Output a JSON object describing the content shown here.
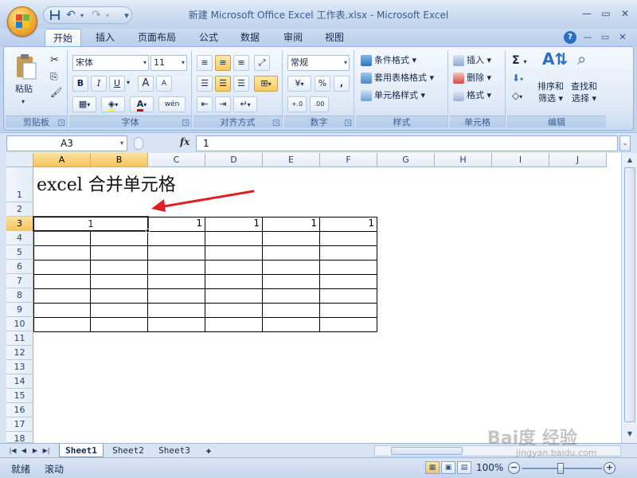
{
  "window": {
    "title": "新建 Microsoft Office Excel 工作表.xlsx - Microsoft Excel",
    "minimize": "—",
    "restore": "❐",
    "close": "✕"
  },
  "qat": {
    "save_icon": "save-icon",
    "undo": "↶",
    "redo": "↷",
    "customize": "▾"
  },
  "tabs": [
    "开始",
    "插入",
    "页面布局",
    "公式",
    "数据",
    "审阅",
    "视图"
  ],
  "ribbon": {
    "clipboard": {
      "label": "剪贴板",
      "paste": "粘贴"
    },
    "font": {
      "label": "字体",
      "name": "宋体",
      "size": "11",
      "bold": "B",
      "italic": "I",
      "underline": "U",
      "grow": "A",
      "shrink": "A",
      "phonetic": "wén"
    },
    "alignment": {
      "label": "对齐方式"
    },
    "number": {
      "label": "数字",
      "format": "常规",
      "percent": "%",
      "comma": ",",
      "inc": "+.0 .00",
      "dec": ".00 →.0"
    },
    "styles": {
      "label": "样式",
      "conditional": "条件格式",
      "table": "套用表格格式",
      "cell": "单元格样式"
    },
    "cells": {
      "label": "单元格",
      "insert": "插入",
      "delete": "删除",
      "format": "格式"
    },
    "editing": {
      "label": "编辑",
      "sum": "Σ",
      "sort": "排序和\n筛选",
      "find": "查找和\n选择",
      "sort_line1": "排序和",
      "sort_line2": "筛选",
      "find_line1": "查找和",
      "find_line2": "选择"
    }
  },
  "formula_bar": {
    "name_box": "A3",
    "fx": "fx",
    "value": "1"
  },
  "columns": [
    "A",
    "B",
    "C",
    "D",
    "E",
    "F",
    "G",
    "H",
    "I",
    "J"
  ],
  "rows": [
    "1",
    "2",
    "3",
    "4",
    "5",
    "6",
    "7",
    "8",
    "9",
    "10",
    "11",
    "12",
    "13",
    "14",
    "15",
    "16",
    "17",
    "18"
  ],
  "cells": {
    "A1": "excel 合并单元格",
    "A3_merged": "1",
    "C3": "1",
    "D3": "1",
    "E3": "1",
    "F3": "1"
  },
  "sheets": [
    "Sheet1",
    "Sheet2",
    "Sheet3"
  ],
  "status": {
    "ready": "就绪",
    "scroll": "滚动",
    "zoom": "100%"
  },
  "watermark": {
    "main": "Bai度 经验",
    "url": "jingyan.baidu.com"
  }
}
